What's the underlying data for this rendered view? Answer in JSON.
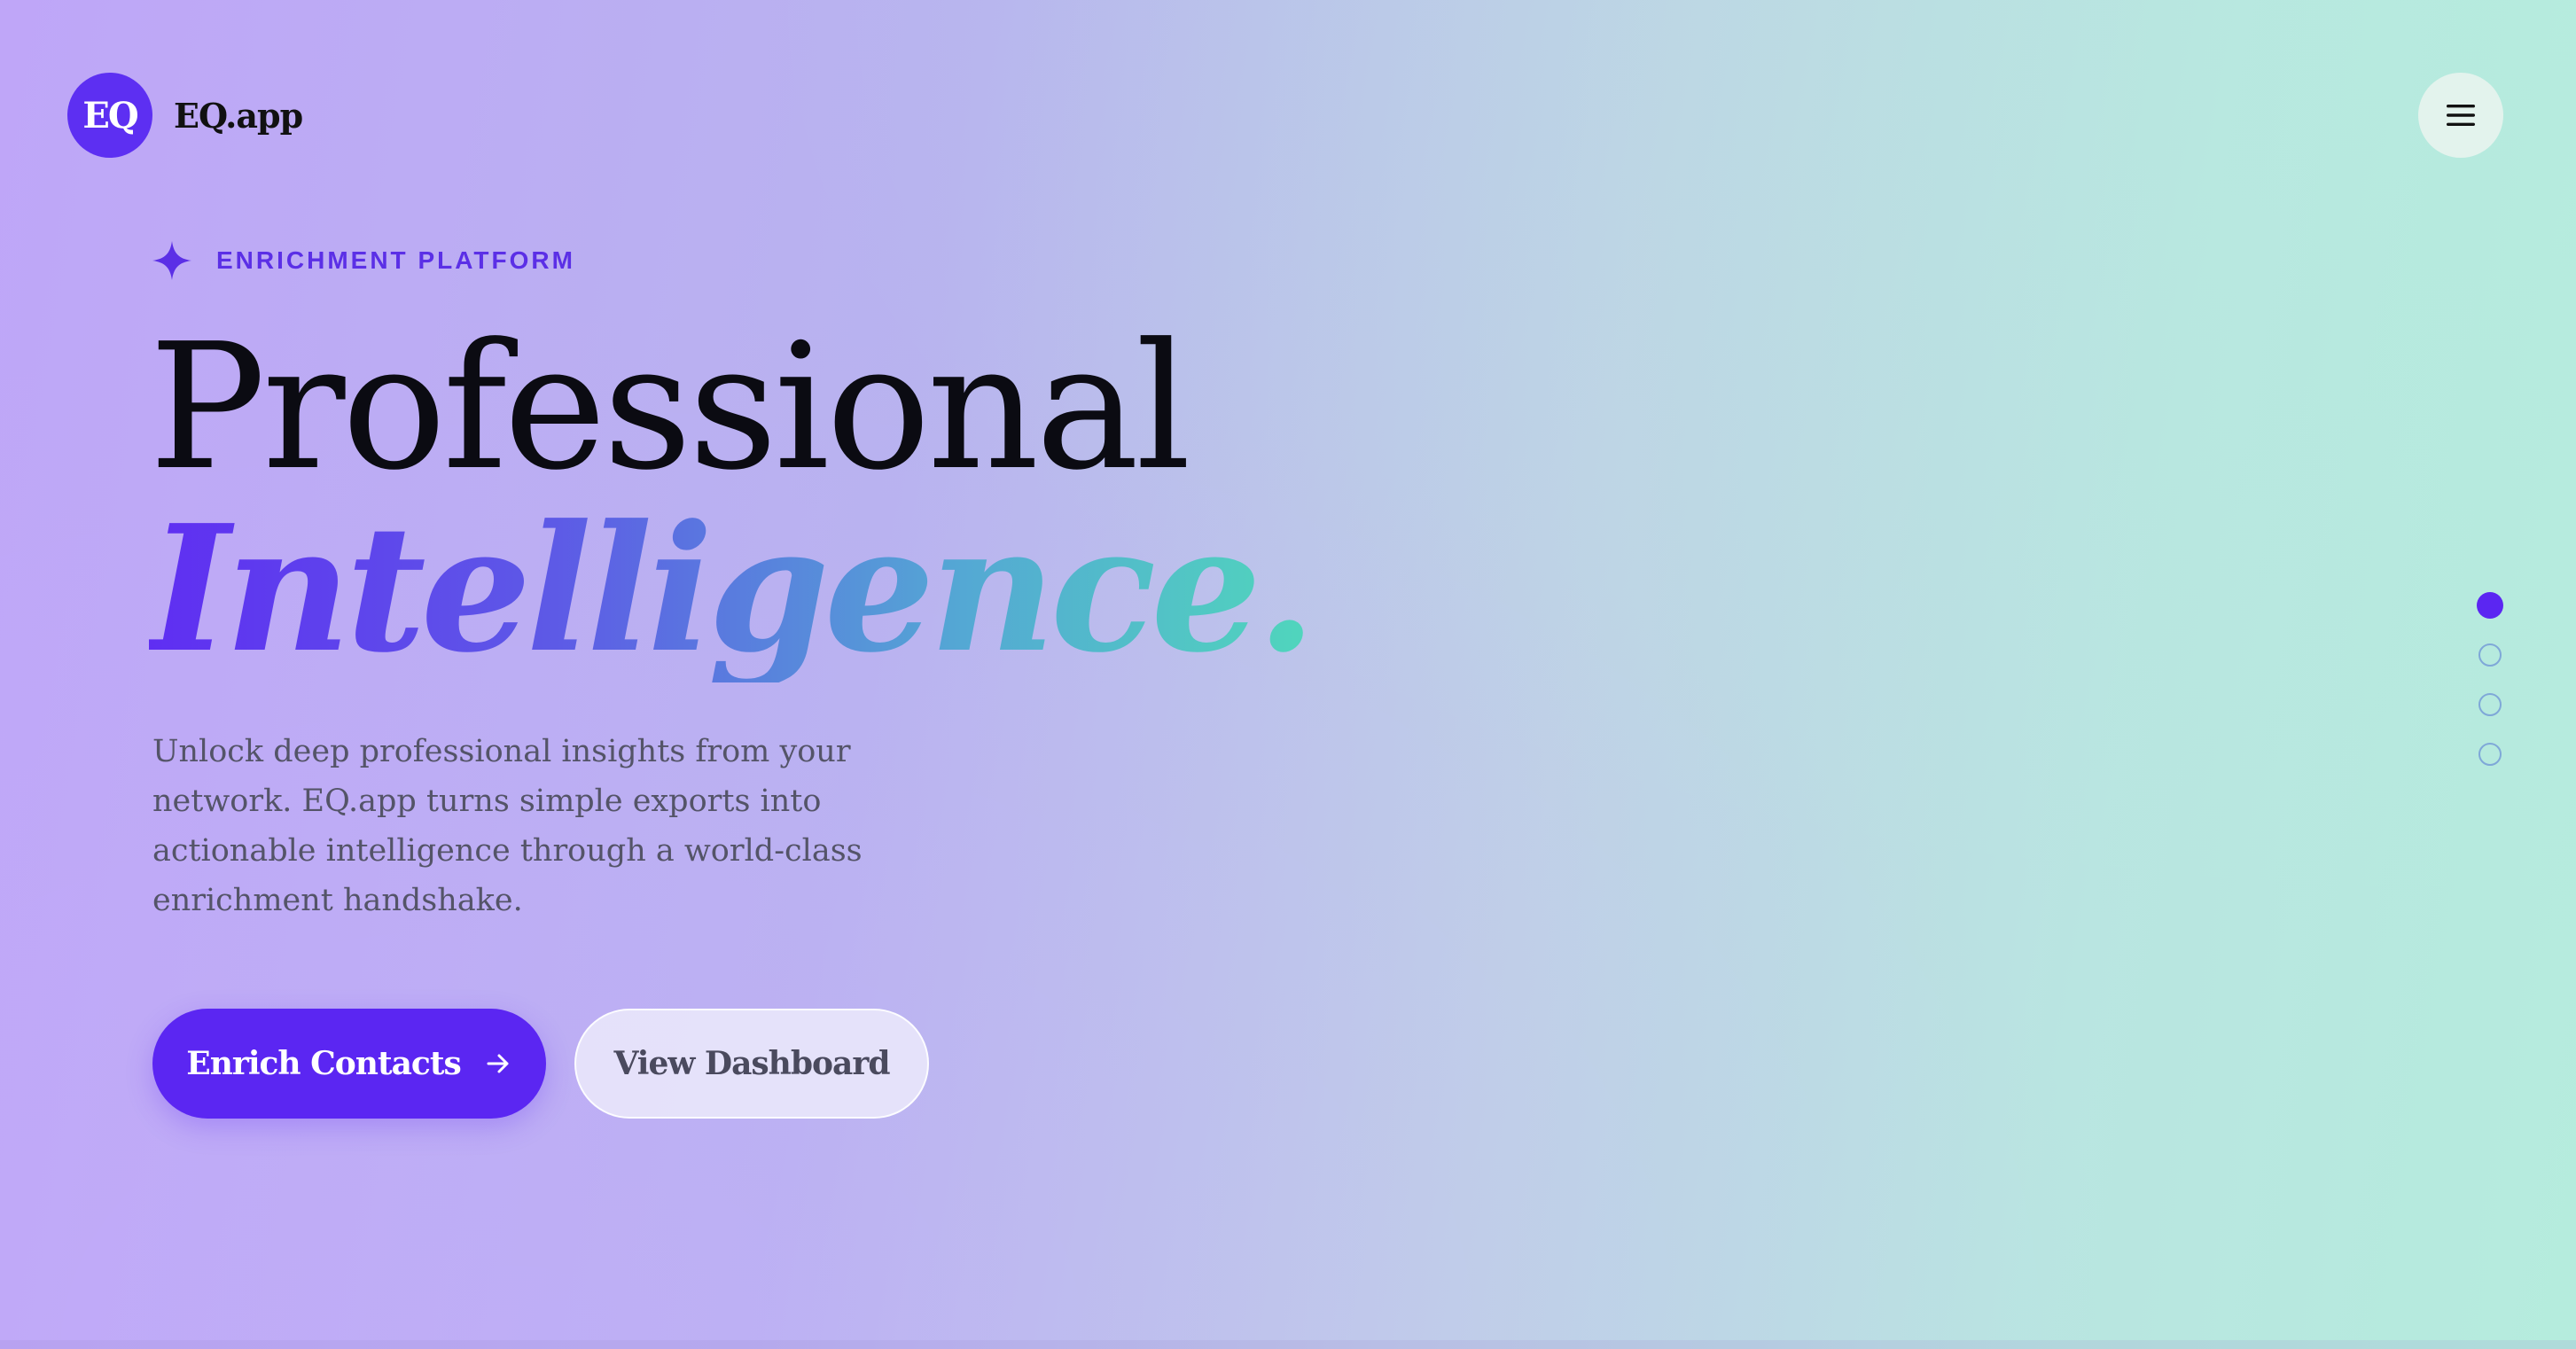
{
  "header": {
    "logo_mark": "EQ",
    "logo_text": "EQ.app",
    "menu_icon": "hamburger-menu-icon"
  },
  "hero": {
    "eyebrow_icon": "sparkle-icon",
    "eyebrow": "ENRICHMENT PLATFORM",
    "headline_line1": "Professional",
    "headline_line2": "Intelligence.",
    "description": "Unlock deep professional insights from your network. EQ.app turns simple exports into actionable intelligence through a world-class enrichment handshake."
  },
  "actions": {
    "primary_label": "Enrich Contacts",
    "primary_icon": "arrow-right-icon",
    "secondary_label": "View Dashboard"
  },
  "pagination": {
    "total": 4,
    "active_index": 0
  },
  "colors": {
    "brand": "#5b26f2",
    "gradient_start": "#5f2ef2",
    "gradient_end": "#50d6bc"
  }
}
